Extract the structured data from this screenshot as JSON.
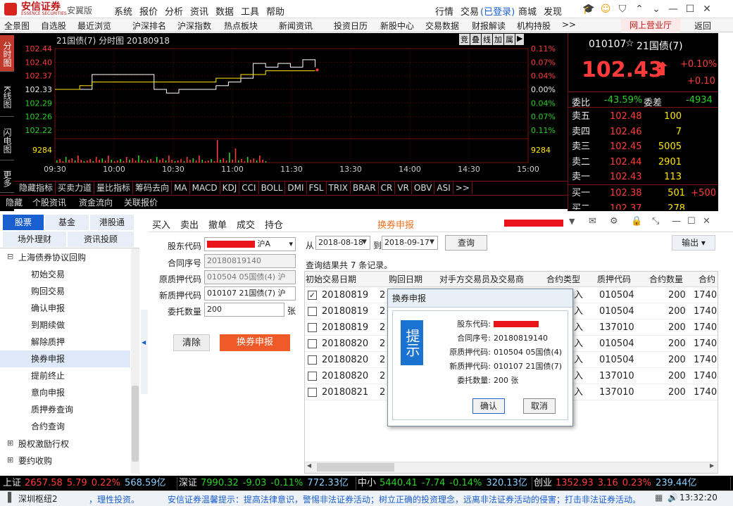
{
  "app": {
    "brand": "安信证券",
    "brand_sub": "ESSENCE SECURITIES",
    "edition": "安翼版",
    "menu": [
      "系统",
      "报价",
      "分析",
      "资讯",
      "数据",
      "工具",
      "帮助"
    ],
    "right_menu": [
      "行情",
      "交易",
      "(已登录)",
      "商城",
      "发现"
    ]
  },
  "toolbar": {
    "items": [
      "全景图",
      "自选股",
      "最近浏览",
      "沪深排名",
      "沪深指数",
      "热点板块",
      "新闻资讯",
      "投资日历",
      "新股中心",
      "交易数据",
      "财报解读",
      "机构持股",
      ">>"
    ],
    "online_hall": "网上营业厅",
    "back": "返回"
  },
  "chart_tabs": [
    "分时图",
    "K线图",
    "闪电图",
    "更多"
  ],
  "chart": {
    "title": "21国债(7) 分时图 20180918",
    "buttons": [
      "竞",
      "叠",
      "线",
      "加",
      "属",
      "▶"
    ],
    "ylabels_left": [
      "102.44",
      "102.40",
      "102.37",
      "102.33",
      "102.29",
      "102.26",
      "102.22"
    ],
    "ylabels_right": [
      "0.11%",
      "0.07%",
      "0.04%",
      "0.00%",
      "0.04%",
      "0.07%",
      "0.11%"
    ],
    "volume_label": "9284",
    "xlabels": [
      "09:30",
      "10:00",
      "10:30",
      "11:00",
      "11:30",
      "13:30",
      "14:00",
      "14:30",
      "15:00"
    ]
  },
  "chart_data": {
    "type": "line",
    "x": [
      "09:30",
      "09:35",
      "09:40",
      "09:45",
      "09:50",
      "10:00",
      "10:10",
      "10:20",
      "10:30",
      "10:35",
      "10:40",
      "10:50",
      "11:00",
      "11:05",
      "11:10",
      "11:15",
      "11:20",
      "11:25",
      "11:28",
      "11:30",
      "11:35",
      "11:40"
    ],
    "series": [
      {
        "values": [
          102.33,
          102.33,
          102.33,
          102.37,
          102.37,
          102.37,
          102.37,
          102.37,
          102.33,
          102.32,
          102.33,
          102.33,
          102.33,
          102.34,
          102.35,
          102.36,
          102.4,
          102.39,
          102.4,
          102.39,
          102.41,
          102.39
        ]
      },
      {
        "values": [
          102.33,
          102.33,
          102.34,
          102.35,
          102.35,
          102.35,
          102.35,
          102.35,
          102.35,
          102.35,
          102.35,
          102.35,
          102.35,
          102.36,
          102.36,
          102.37,
          102.37,
          102.38,
          102.38,
          102.38,
          102.38,
          102.38
        ]
      }
    ],
    "ylim": [
      102.22,
      102.44
    ]
  },
  "indicators": [
    "隐藏指标",
    "买卖力道",
    "量比指标",
    "筹码去向",
    "MA",
    "MACD",
    "KDJ",
    "CCI",
    "BOLL",
    "DMI",
    "FSL",
    "TRIX",
    "BRAR",
    "CR",
    "VR",
    "OBV",
    "ASI",
    ">>"
  ],
  "links": [
    "隐藏",
    "个股资讯",
    "资金流向",
    "关联报价"
  ],
  "quote": {
    "code": "010107",
    "name": "21国债(7)",
    "price": "102.43",
    "change_pct": "+0.10%",
    "change": "+0.10",
    "webi_label": "委比",
    "webi": "-43.59%",
    "wecha_label": "委差",
    "wecha": "-4934",
    "asks": [
      {
        "label": "卖五",
        "price": "102.48",
        "vol": "100"
      },
      {
        "label": "卖四",
        "price": "102.46",
        "vol": "7"
      },
      {
        "label": "卖三",
        "price": "102.45",
        "vol": "5005"
      },
      {
        "label": "卖二",
        "price": "102.44",
        "vol": "2901"
      },
      {
        "label": "卖一",
        "price": "102.43",
        "vol": "113"
      }
    ],
    "bids": [
      {
        "label": "买一",
        "price": "102.38",
        "vol": "501",
        "extra": "+500"
      },
      {
        "label": "买二",
        "price": "102.37",
        "vol": "278",
        "extra": ""
      }
    ]
  },
  "nav": {
    "tabs_row1": [
      "股票",
      "基金",
      "港股通"
    ],
    "tabs_row2": [
      "场外理财",
      "资讯投顾"
    ],
    "tree_root": "上海债券协议回购",
    "tree_items": [
      "初始交易",
      "购回交易",
      "确认申报",
      "到期续做",
      "解除质押",
      "换券申报",
      "提前终止",
      "意向申报",
      "质押券查询",
      "合约查询"
    ],
    "tree_more": [
      "股权激励行权",
      "要约收购"
    ]
  },
  "trade": {
    "tabs": [
      "买入",
      "卖出",
      "撤单",
      "成交",
      "持仓"
    ],
    "title": "换券申报",
    "account_suffix": "沪A",
    "form": {
      "shareholder_label": "股东代码",
      "contract_label": "合同序号",
      "contract_value": "20180819140",
      "old_label": "原质押代码",
      "old_value": "010504  05国债(4)  沪",
      "new_label": "新质押代码",
      "new_value": "010107  21国债(7)  沪",
      "qty_label": "委托数量",
      "qty_value": "200",
      "qty_unit": "张",
      "clear_btn": "清除",
      "submit_btn": "换券申报"
    },
    "query": {
      "from_label": "从",
      "from_date": "2018-08-18",
      "to_label": "到",
      "to_date": "2018-09-17",
      "query_btn": "查询",
      "export_btn": "输出",
      "result_text": "查询结果共 7 条记录。"
    },
    "table": {
      "headers": [
        "初始交易日期",
        "购回日期",
        "对手方交易员及交易商",
        "合约类型",
        "质押代码",
        "合约数量",
        "合约"
      ],
      "rows": [
        {
          "date": "20180819",
          "buyback": "2",
          "type": "入",
          "code": "010504",
          "qty": "200",
          "more": "1740",
          "checked": true
        },
        {
          "date": "20180819",
          "buyback": "2",
          "type": "入",
          "code": "010504",
          "qty": "200",
          "more": "1740",
          "checked": false
        },
        {
          "date": "20180819",
          "buyback": "2",
          "type": "入",
          "code": "137010",
          "qty": "200",
          "more": "1740",
          "checked": false
        },
        {
          "date": "20180820",
          "buyback": "2",
          "type": "入",
          "code": "010504",
          "qty": "200",
          "more": "1740",
          "checked": false
        },
        {
          "date": "20180820",
          "buyback": "2",
          "type": "入",
          "code": "010504",
          "qty": "200",
          "more": "1740",
          "checked": false
        },
        {
          "date": "20180820",
          "buyback": "2",
          "type": "入",
          "code": "137010",
          "qty": "200",
          "more": "1740",
          "checked": false
        },
        {
          "date": "20180821",
          "buyback": "2",
          "type": "入",
          "code": "137010",
          "qty": "200",
          "more": "1740",
          "checked": false
        }
      ]
    }
  },
  "modal": {
    "title": "换券申报",
    "badge": "提示",
    "lines": [
      {
        "label": "股东代码:",
        "value": ""
      },
      {
        "label": "合同序号:",
        "value": "20180819140"
      },
      {
        "label": "原质押代码:",
        "value": "010504   05国债(4)"
      },
      {
        "label": "新质押代码:",
        "value": "010107   21国债(7)"
      },
      {
        "label": "委托数量:",
        "value": "200 张"
      }
    ],
    "ok": "确认",
    "cancel": "取消"
  },
  "indices": [
    {
      "name": "上证",
      "value": "2657.58",
      "chg": "5.79",
      "pct": "0.22%",
      "amt": "568.59亿",
      "dir": "up"
    },
    {
      "name": "深证",
      "value": "7990.32",
      "chg": "-9.03",
      "pct": "-0.11%",
      "amt": "772.33亿",
      "dir": "down"
    },
    {
      "name": "中小",
      "value": "5440.41",
      "chg": "-7.74",
      "pct": "-0.14%",
      "amt": "320.13亿",
      "dir": "down"
    },
    {
      "name": "创业",
      "value": "1352.93",
      "chg": "3.16",
      "pct": "0.23%",
      "amt": "239.44亿",
      "dir": "up"
    }
  ],
  "ticker": {
    "server": "深圳枢纽2",
    "risk": "，理性投资。",
    "notice": "安信证券温馨提示：提高法律意识，警惕非法证券活动；树立正确的投资理念，远离非法证券活动的侵害；打击非法证券活动。",
    "time": "13:32:20"
  },
  "colors": {
    "accent": "#c01919",
    "up": "#ff3b3b",
    "down": "#2ad12a",
    "price_line": "#ffffff",
    "avg_line": "#ffe600",
    "submit": "#f05a28"
  }
}
